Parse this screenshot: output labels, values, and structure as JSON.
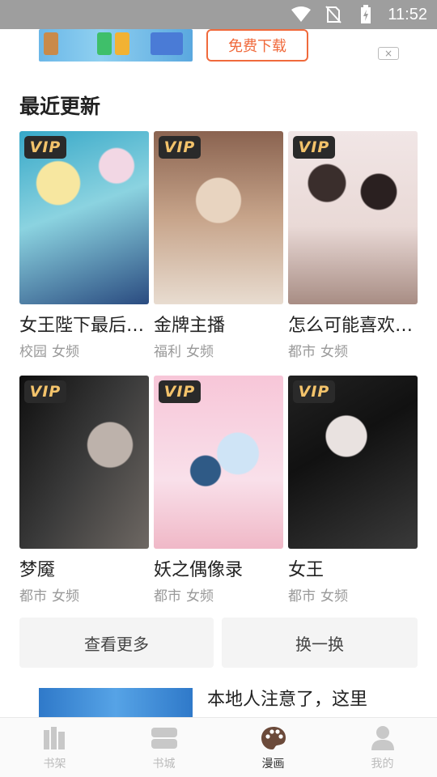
{
  "status_bar": {
    "time": "11:52",
    "icons": [
      "wifi-icon",
      "no-sim-icon",
      "battery-charging-icon"
    ]
  },
  "top_ad": {
    "download_label": "免费下载",
    "close_label": "×"
  },
  "section": {
    "title": "最近更新"
  },
  "comics": [
    {
      "title": "女王陛下最后…",
      "badge": "VIP",
      "tags": [
        "校园",
        "女频"
      ]
    },
    {
      "title": "金牌主播",
      "badge": "VIP",
      "tags": [
        "福利",
        "女频"
      ]
    },
    {
      "title": "怎么可能喜欢…",
      "badge": "VIP",
      "tags": [
        "都市",
        "女频"
      ]
    },
    {
      "title": "梦魇",
      "badge": "VIP",
      "tags": [
        "都市",
        "女频"
      ]
    },
    {
      "title": "妖之偶像录",
      "badge": "VIP",
      "tags": [
        "都市",
        "女频"
      ]
    },
    {
      "title": "女王",
      "badge": "VIP",
      "tags": [
        "都市",
        "女频"
      ]
    }
  ],
  "actions": {
    "more_label": "查看更多",
    "refresh_label": "换一换"
  },
  "bottom_ad": {
    "text": "本地人注意了，这里"
  },
  "tabs": [
    {
      "label": "书架",
      "icon": "bookshelf-icon",
      "active": false
    },
    {
      "label": "书城",
      "icon": "bookstore-icon",
      "active": false
    },
    {
      "label": "漫画",
      "icon": "comic-palette-icon",
      "active": true
    },
    {
      "label": "我的",
      "icon": "profile-icon",
      "active": false
    }
  ],
  "colors": {
    "accent": "#f06a3c",
    "vip_text": "#f3c36b",
    "active_tab_icon": "#6b4a3a"
  }
}
